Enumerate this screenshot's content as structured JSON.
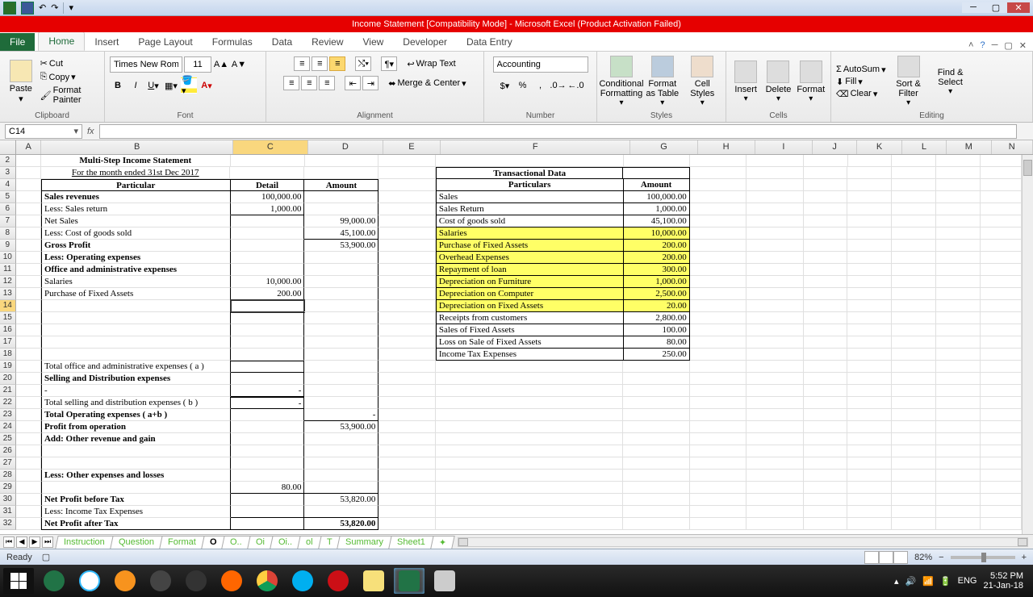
{
  "title": "Income Statement  [Compatibility Mode] - Microsoft Excel (Product Activation Failed)",
  "ribbon": {
    "file": "File",
    "tabs": [
      "Home",
      "Insert",
      "Page Layout",
      "Formulas",
      "Data",
      "Review",
      "View",
      "Developer",
      "Data Entry"
    ],
    "active_tab": "Home",
    "clipboard": {
      "label": "Clipboard",
      "paste": "Paste",
      "cut": "Cut",
      "copy": "Copy",
      "fmtpaint": "Format Painter"
    },
    "font": {
      "label": "Font",
      "family": "Times New Roman",
      "size": "11"
    },
    "alignment": {
      "label": "Alignment",
      "wraptext": "Wrap Text",
      "merge": "Merge & Center"
    },
    "number": {
      "label": "Number",
      "format": "Accounting"
    },
    "styles": {
      "label": "Styles",
      "cond": "Conditional Formatting",
      "table": "Format as Table",
      "cell": "Cell Styles"
    },
    "cells": {
      "label": "Cells",
      "insert": "Insert",
      "delete": "Delete",
      "format": "Format"
    },
    "editing": {
      "label": "Editing",
      "autosum": "AutoSum",
      "fill": "Fill",
      "clear": "Clear",
      "sort": "Sort & Filter",
      "find": "Find & Select"
    }
  },
  "namebox": "C14",
  "columns": [
    "A",
    "B",
    "C",
    "D",
    "E",
    "F",
    "G",
    "H",
    "I",
    "J",
    "K",
    "L",
    "M",
    "N"
  ],
  "rows_shown": 31,
  "sheet": {
    "title": "Multi-Step Income Statement",
    "subtitle": "For the month ended 31st Dec 2017",
    "headers": {
      "particular": "Particular",
      "detail": "Detail",
      "amount": "Amount"
    },
    "trans_header": "Transactional Data",
    "trans_cols": {
      "particulars": "Particulars",
      "amount": "Amount"
    },
    "lines": {
      "sales_revenues": "Sales revenues",
      "less_sales_return": "Less: Sales return",
      "net_sales": "Net Sales",
      "less_cogs": "Less: Cost of goods sold",
      "gross_profit": "Gross Profit",
      "less_opex": "Less: Operating expenses",
      "office_admin": "Office and administrative expenses",
      "salaries": "   Salaries",
      "purchase_fa": "   Purchase of Fixed Assets",
      "total_office": "Total office and administrative expenses ( a )",
      "selling_dist": "Selling and Distribution expenses",
      "dash": "   -",
      "total_selling": "Total selling and distribution expenses ( b )",
      "total_opex": "Total Operating expenses ( a+b )",
      "profit_op": "Profit from operation",
      "add_other_rev": "Add: Other revenue and gain",
      "less_other_exp": "Less: Other expenses and losses",
      "net_before_tax": "Net Profit before Tax",
      "less_income_tax": "Less: Income Tax Expenses",
      "net_after_tax": "Net Profit after Tax"
    },
    "values": {
      "sales_rev_detail": "100,000.00",
      "sales_return_detail": "1,000.00",
      "net_sales_amount": "99,000.00",
      "cogs_amount": "45,100.00",
      "gross_profit_amount": "53,900.00",
      "salaries_detail": "10,000.00",
      "purchase_fa_detail": "200.00",
      "selling_dash": "-",
      "total_selling_dash": "-",
      "total_opex_amount": "-",
      "profit_op_amount": "53,900.00",
      "other_exp_detail": "80.00",
      "net_before_tax_amount": "53,820.00",
      "net_after_tax_amount": "53,820.00"
    },
    "trans": [
      {
        "p": "Sales",
        "a": "100,000.00",
        "y": false
      },
      {
        "p": "Sales Return",
        "a": "1,000.00",
        "y": false
      },
      {
        "p": "Cost of goods sold",
        "a": "45,100.00",
        "y": false
      },
      {
        "p": "Salaries",
        "a": "10,000.00",
        "y": true
      },
      {
        "p": "Purchase of Fixed Assets",
        "a": "200.00",
        "y": true
      },
      {
        "p": "Overhead Expenses",
        "a": "200.00",
        "y": true
      },
      {
        "p": "Repayment of loan",
        "a": "300.00",
        "y": true
      },
      {
        "p": "Depreciation on Furniture",
        "a": "1,000.00",
        "y": true
      },
      {
        "p": "Depreciation on Computer",
        "a": "2,500.00",
        "y": true
      },
      {
        "p": "Depreciation on Fixed Assets",
        "a": "20.00",
        "y": true
      },
      {
        "p": "Receipts from customers",
        "a": "2,800.00",
        "y": false
      },
      {
        "p": "Sales of Fixed Assets",
        "a": "100.00",
        "y": false
      },
      {
        "p": "Loss on Sale of Fixed Assets",
        "a": "80.00",
        "y": false
      },
      {
        "p": "Income Tax Expenses",
        "a": "250.00",
        "y": false
      }
    ]
  },
  "sheettabs": [
    "Instruction",
    "Question",
    "Format",
    "O",
    "O..",
    "Oi",
    "Oi..",
    "ol",
    "T",
    "Summary",
    "Sheet1"
  ],
  "active_sheet": "O",
  "status": {
    "ready": "Ready",
    "zoom": "82%"
  },
  "tray": {
    "lang": "ENG",
    "time": "5:52 PM",
    "date": "21-Jan-18"
  }
}
